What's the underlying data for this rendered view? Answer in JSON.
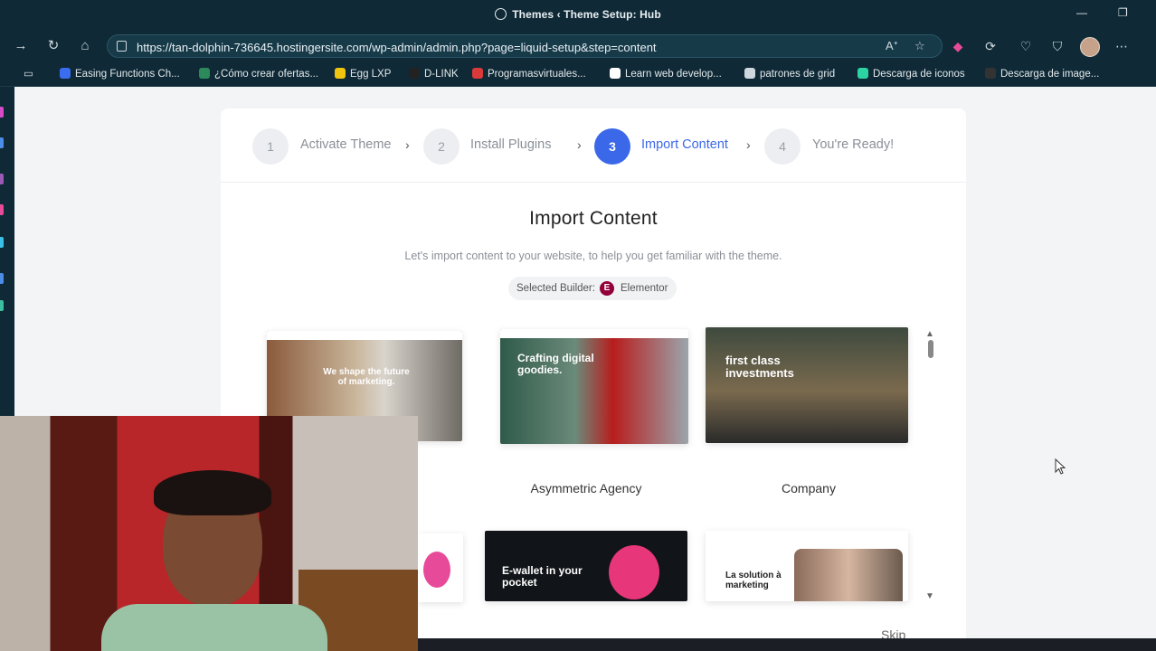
{
  "browser": {
    "window_title": "Themes ‹ Theme Setup: Hub",
    "url": "https://tan-dolphin-736645.hostingersite.com/wp-admin/admin.php?page=liquid-setup&step=content",
    "bookmarks": [
      {
        "label": "Easing Functions Ch...",
        "color": "#3a6df0"
      },
      {
        "label": "¿Cómo crear ofertas...",
        "color": "#2c8a5a"
      },
      {
        "label": "Egg LXP",
        "color": "#f1c40f"
      },
      {
        "label": "D-LINK",
        "color": "#222222"
      },
      {
        "label": "Programasvirtuales...",
        "color": "#d93a3a"
      },
      {
        "label": "Learn web develop...",
        "color": "#ffffff"
      },
      {
        "label": "patrones de grid",
        "color": "#cfd8de"
      },
      {
        "label": "Descarga de iconos",
        "color": "#2bd4a0"
      },
      {
        "label": "Descarga de image...",
        "color": "#333333"
      }
    ]
  },
  "wizard": {
    "steps": [
      {
        "number": "1",
        "label": "Activate Theme",
        "active": false
      },
      {
        "number": "2",
        "label": "Install Plugins",
        "active": false
      },
      {
        "number": "3",
        "label": "Import Content",
        "active": true
      },
      {
        "number": "4",
        "label": "You're Ready!",
        "active": false
      }
    ],
    "title": "Import Content",
    "subtitle": "Let's import content to your website, to help you get familiar with the theme.",
    "builder_label": "Selected Builder:",
    "builder_value": "Elementor",
    "demos": [
      {
        "name": "",
        "headline": "We shape the future of marketing."
      },
      {
        "name": "Asymmetric Agency",
        "headline": "Crafting digital goodies."
      },
      {
        "name": "Company",
        "headline": "first class investments"
      },
      {
        "name": "",
        "headline": ""
      },
      {
        "name": "",
        "headline": "E-wallet in your pocket"
      },
      {
        "name": "",
        "headline": "La solution à marketing"
      }
    ],
    "skip_label": "Skip"
  },
  "colors": {
    "accent": "#3b68e8",
    "browser_chrome": "#0f2a36",
    "elementor": "#92003b"
  }
}
